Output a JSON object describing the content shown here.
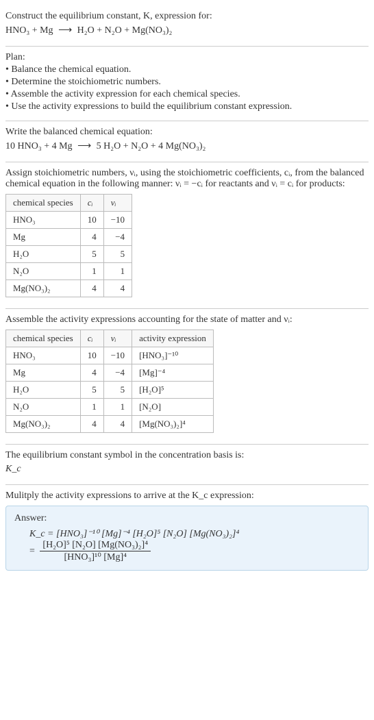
{
  "header": {
    "intro": "Construct the equilibrium constant, K, expression for:",
    "reaction_lhs": "HNO₃ + Mg",
    "reaction_rhs": "H₂O + N₂O + Mg(NO₃)₂"
  },
  "plan": {
    "title": "Plan:",
    "items": [
      "• Balance the chemical equation.",
      "• Determine the stoichiometric numbers.",
      "• Assemble the activity expression for each chemical species.",
      "• Use the activity expressions to build the equilibrium constant expression."
    ]
  },
  "balanced": {
    "title": "Write the balanced chemical equation:",
    "lhs": "10 HNO₃ + 4 Mg",
    "rhs": "5 H₂O + N₂O + 4 Mg(NO₃)₂"
  },
  "stoich_text": "Assign stoichiometric numbers, νᵢ, using the stoichiometric coefficients, cᵢ, from the balanced chemical equation in the following manner: νᵢ = −cᵢ for reactants and νᵢ = cᵢ for products:",
  "stoich_table": {
    "headers": [
      "chemical species",
      "cᵢ",
      "νᵢ"
    ],
    "rows": [
      {
        "species": "HNO₃",
        "c": "10",
        "v": "−10"
      },
      {
        "species": "Mg",
        "c": "4",
        "v": "−4"
      },
      {
        "species": "H₂O",
        "c": "5",
        "v": "5"
      },
      {
        "species": "N₂O",
        "c": "1",
        "v": "1"
      },
      {
        "species": "Mg(NO₃)₂",
        "c": "4",
        "v": "4"
      }
    ]
  },
  "activity_text": "Assemble the activity expressions accounting for the state of matter and νᵢ:",
  "activity_table": {
    "headers": [
      "chemical species",
      "cᵢ",
      "νᵢ",
      "activity expression"
    ],
    "rows": [
      {
        "species": "HNO₃",
        "c": "10",
        "v": "−10",
        "expr": "[HNO₃]⁻¹⁰"
      },
      {
        "species": "Mg",
        "c": "4",
        "v": "−4",
        "expr": "[Mg]⁻⁴"
      },
      {
        "species": "H₂O",
        "c": "5",
        "v": "5",
        "expr": "[H₂O]⁵"
      },
      {
        "species": "N₂O",
        "c": "1",
        "v": "1",
        "expr": "[N₂O]"
      },
      {
        "species": "Mg(NO₃)₂",
        "c": "4",
        "v": "4",
        "expr": "[Mg(NO₃)₂]⁴"
      }
    ]
  },
  "kc_symbol_text": "The equilibrium constant symbol in the concentration basis is:",
  "kc_symbol": "K_c",
  "multiply_text": "Mulitply the activity expressions to arrive at the K_c expression:",
  "answer": {
    "label": "Answer:",
    "flat": "K_c = [HNO₃]⁻¹⁰ [Mg]⁻⁴ [H₂O]⁵ [N₂O] [Mg(NO₃)₂]⁴",
    "frac_num": "[H₂O]⁵ [N₂O] [Mg(NO₃)₂]⁴",
    "frac_den": "[HNO₃]¹⁰ [Mg]⁴",
    "equals": "="
  },
  "arrow": "⟶"
}
